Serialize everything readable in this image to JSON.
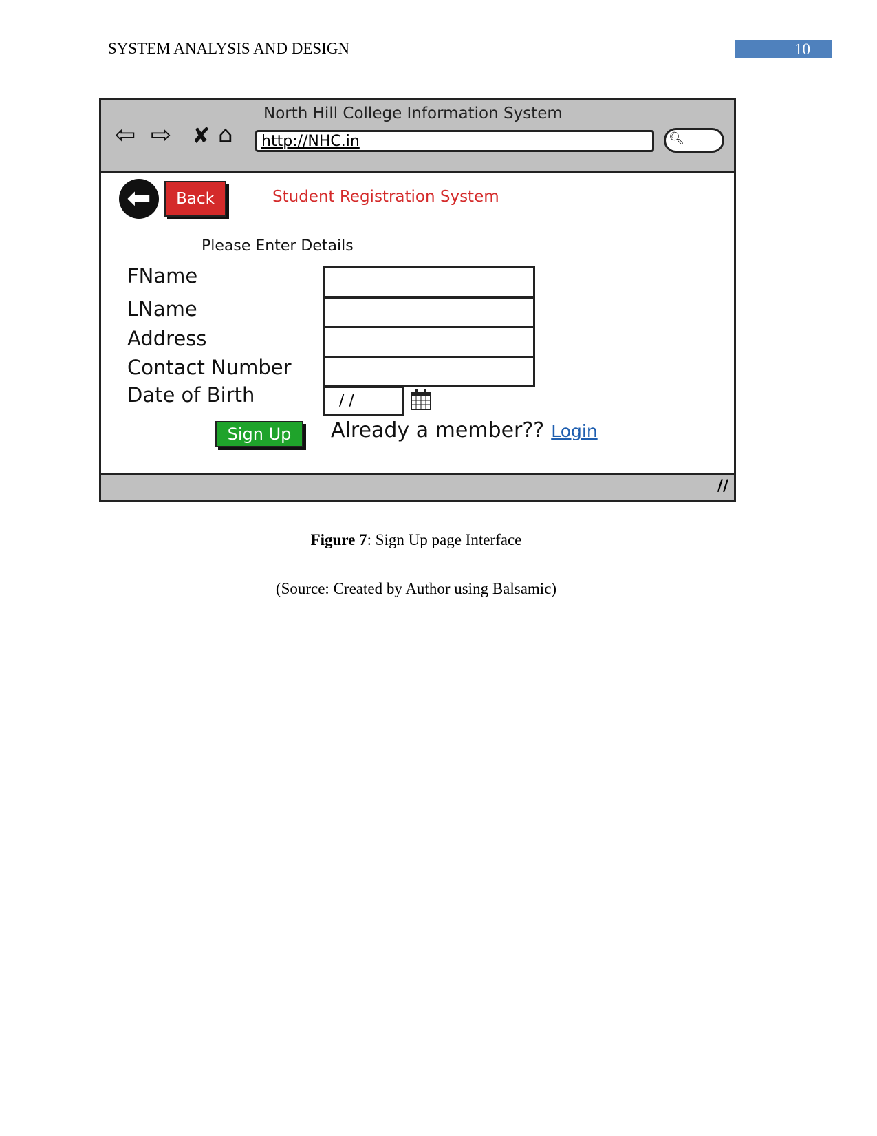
{
  "header": {
    "title": "SYSTEM ANALYSIS AND DESIGN",
    "page_number": "10",
    "page_number_color": "#4f81bd"
  },
  "mockup": {
    "window_title": "North Hill College Information System",
    "url": "http://NHC.in",
    "nav_icons": [
      "arrow-left-icon",
      "arrow-right-icon",
      "close-icon",
      "home-icon",
      "search-icon"
    ],
    "back_label": "Back",
    "app_title": "Student Registration System",
    "subtitle": "Please Enter Details",
    "fields": [
      {
        "label": "FName",
        "value": ""
      },
      {
        "label": "LName",
        "value": ""
      },
      {
        "label": "Address",
        "value": ""
      },
      {
        "label": "Contact Number",
        "value": ""
      },
      {
        "label": "Date of Birth",
        "value": "/ /"
      }
    ],
    "signup_label": "Sign Up",
    "member_text": "Already a member??",
    "login_label": "Login",
    "colors": {
      "back": "#d42a2a",
      "signup": "#1fa32b",
      "link": "#1f5fb0",
      "chrome": "#c0c0c0"
    }
  },
  "caption": {
    "figure_label": "Figure 7",
    "figure_text": ": Sign Up page Interface",
    "source": "(Source: Created by Author using Balsamic)"
  }
}
